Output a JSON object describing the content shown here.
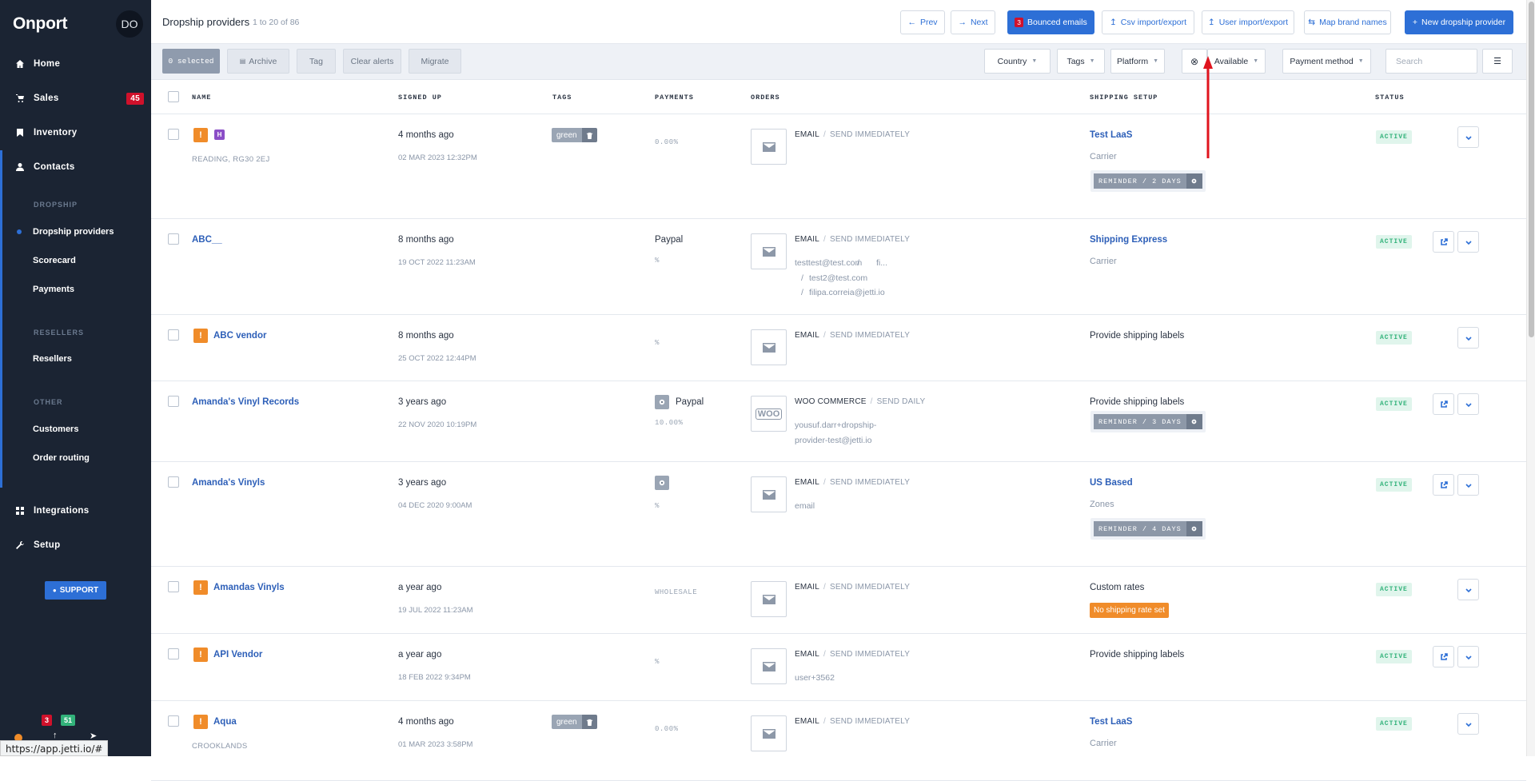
{
  "app": {
    "logo": "Onport",
    "avatar": "DO",
    "url": "https://app.jetti.io/#"
  },
  "sidebar": {
    "items": [
      {
        "label": "Home",
        "icon": "home-icon"
      },
      {
        "label": "Sales",
        "icon": "cart-icon",
        "badge": "45"
      },
      {
        "label": "Inventory",
        "icon": "bookmark-icon"
      },
      {
        "label": "Contacts",
        "icon": "user-icon"
      },
      {
        "label": "Integrations",
        "icon": "grid-icon"
      },
      {
        "label": "Setup",
        "icon": "wrench-icon"
      }
    ],
    "sections": {
      "dropship": {
        "title": "DROPSHIP",
        "items": [
          "Dropship providers",
          "Scorecard",
          "Payments"
        ]
      },
      "resellers": {
        "title": "RESELLERS",
        "items": [
          "Resellers"
        ]
      },
      "other": {
        "title": "OTHER",
        "items": [
          "Customers",
          "Order routing"
        ]
      }
    },
    "support": "SUPPORT",
    "mini_badges": [
      "3",
      "51"
    ]
  },
  "header": {
    "title": "Dropship providers",
    "count": "1 to 20 of 86",
    "buttons": {
      "prev": "Prev",
      "next": "Next",
      "bounced": "Bounced emails",
      "bounced_count": "3",
      "csv": "Csv import/export",
      "user_import": "User import/export",
      "map_brand": "Map brand names",
      "new_provider": "New dropship provider"
    }
  },
  "filters": {
    "selected": "0 selected",
    "archive": "Archive",
    "tag": "Tag",
    "clear_alerts": "Clear alerts",
    "migrate": "Migrate",
    "country": "Country",
    "tags": "Tags",
    "platform": "Platform",
    "available": "Available",
    "payment_method": "Payment method",
    "search_placeholder": "Search"
  },
  "columns": {
    "name": "NAME",
    "signed_up": "SIGNED UP",
    "tags": "TAGS",
    "payments": "PAYMENTS",
    "orders": "ORDERS",
    "shipping_setup": "SHIPPING SETUP",
    "status": "STATUS"
  },
  "rows": [
    {
      "name": "",
      "location": "READING, RG30 2EJ",
      "signed": "4 months ago",
      "date": "02 MAR 2023 12:32PM",
      "tag": "green",
      "pay_label": "",
      "pay_pct": "0.00%",
      "order_type": "EMAIL",
      "order_mode": "SEND IMMEDIATELY",
      "emails": [],
      "ship": "Test LaaS",
      "ship_link": true,
      "ship_sub": "Carrier",
      "reminder": "REMINDER / 2 DAYS",
      "warn_badge": "",
      "status": "ACTIVE"
    },
    {
      "name": "ABC__",
      "location": "",
      "signed": "8 months ago",
      "date": "19 OCT 2022 11:23AM",
      "tag": "",
      "pay_label": "Paypal",
      "pay_pct": "%",
      "order_type": "EMAIL",
      "order_mode": "SEND IMMEDIATELY",
      "emails": [
        "testtest@test.com",
        "/",
        "fi...",
        "/",
        "test2@test.com",
        "/",
        "filipa.correia@jetti.io"
      ],
      "ship": "Shipping Express",
      "ship_link": true,
      "ship_sub": "Carrier",
      "reminder": "",
      "warn_badge": "",
      "status": "ACTIVE"
    },
    {
      "name": "ABC vendor",
      "location": "",
      "signed": "8 months ago",
      "date": "25 OCT 2022 12:44PM",
      "tag": "",
      "pay_label": "",
      "pay_pct": "%",
      "order_type": "EMAIL",
      "order_mode": "SEND IMMEDIATELY",
      "emails": [],
      "ship": "Provide shipping labels",
      "ship_link": false,
      "ship_sub": "",
      "reminder": "",
      "warn_badge": "",
      "status": "ACTIVE"
    },
    {
      "name": "Amanda's Vinyl Records",
      "location": "",
      "signed": "3 years ago",
      "date": "22 NOV 2020 10:19PM",
      "tag": "",
      "pay_label": "Paypal",
      "pay_pct": "10.00%",
      "order_type": "WOO COMMERCE",
      "order_mode": "SEND DAILY",
      "emails": [
        "yousuf.darr+dropship-",
        "provider-test@jetti.io"
      ],
      "ship": "Provide shipping labels",
      "ship_link": false,
      "ship_sub": "",
      "reminder": "REMINDER / 3 DAYS",
      "warn_badge": "",
      "status": "ACTIVE",
      "woo": "WOO"
    },
    {
      "name": "Amanda's Vinyls",
      "location": "",
      "signed": "3 years ago",
      "date": "04 DEC 2020 9:00AM",
      "tag": "",
      "pay_label": "",
      "pay_pct": "%",
      "order_type": "EMAIL",
      "order_mode": "SEND IMMEDIATELY",
      "emails": [
        "email"
      ],
      "ship": "US Based",
      "ship_link": true,
      "ship_sub": "Zones",
      "reminder": "REMINDER / 4 DAYS",
      "warn_badge": "",
      "status": "ACTIVE"
    },
    {
      "name": "Amandas Vinyls",
      "location": "",
      "signed": "a year ago",
      "date": "19 JUL 2022 11:23AM",
      "tag": "",
      "pay_label": "",
      "pay_pct": "WHOLESALE",
      "order_type": "EMAIL",
      "order_mode": "SEND IMMEDIATELY",
      "emails": [],
      "ship": "Custom rates",
      "ship_link": false,
      "ship_sub": "",
      "reminder": "",
      "warn_badge": "No shipping rate set",
      "status": "ACTIVE"
    },
    {
      "name": "API Vendor",
      "location": "",
      "signed": "a year ago",
      "date": "18 FEB 2022 9:34PM",
      "tag": "",
      "pay_label": "",
      "pay_pct": "%",
      "order_type": "EMAIL",
      "order_mode": "SEND IMMEDIATELY",
      "emails": [
        "user+3562"
      ],
      "ship": "Provide shipping labels",
      "ship_link": false,
      "ship_sub": "",
      "reminder": "",
      "warn_badge": "",
      "status": "ACTIVE"
    },
    {
      "name": "Aqua",
      "location": "CROOKLANDS",
      "signed": "4 months ago",
      "date": "01 MAR 2023 3:58PM",
      "tag": "green",
      "pay_label": "",
      "pay_pct": "0.00%",
      "order_type": "EMAIL",
      "order_mode": "SEND IMMEDIATELY",
      "emails": [],
      "ship": "Test LaaS",
      "ship_link": true,
      "ship_sub": "Carrier",
      "reminder": "",
      "warn_badge": "",
      "status": "ACTIVE"
    }
  ],
  "colors": {
    "sidebar": "#1b2433",
    "accent": "#2d6fd6",
    "annotation_arrow": "#e0141e",
    "status_active": "#32b27a",
    "warning": "#f08c2a"
  }
}
